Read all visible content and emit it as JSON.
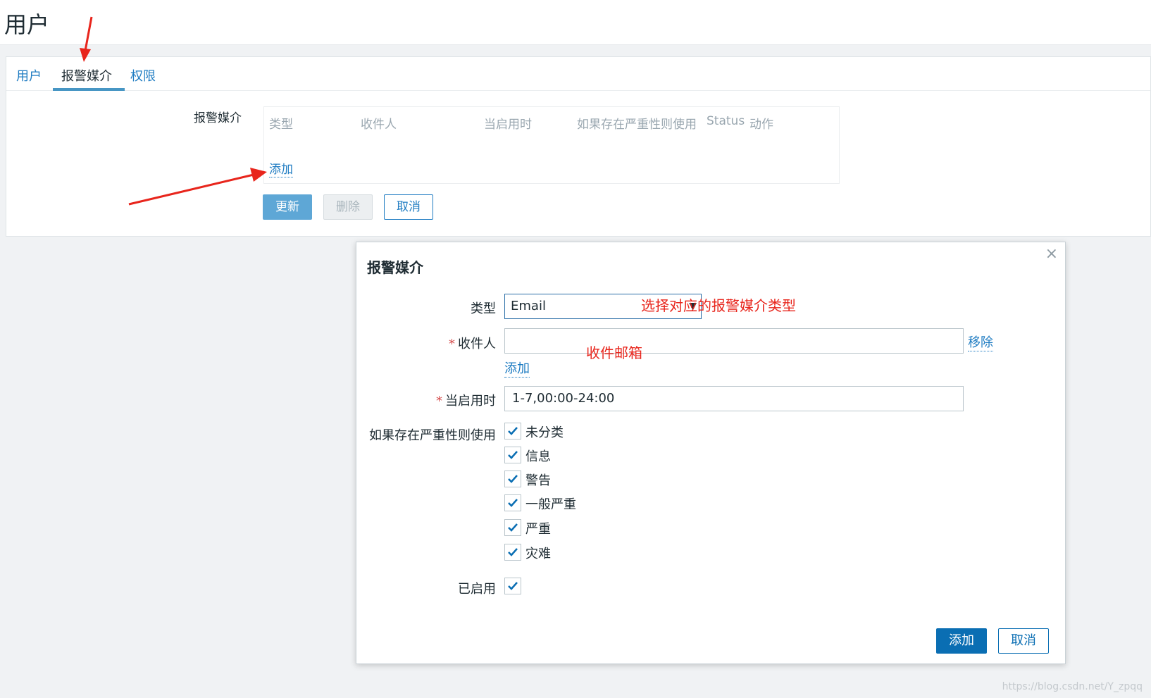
{
  "page": {
    "title": "用户"
  },
  "tabs": [
    {
      "label": "用户",
      "active": false
    },
    {
      "label": "报警媒介",
      "active": true
    },
    {
      "label": "权限",
      "active": false
    }
  ],
  "media_form": {
    "label": "报警媒介",
    "columns": [
      "类型",
      "收件人",
      "当启用时",
      "如果存在严重性则使用",
      "Status",
      "动作"
    ],
    "add_link": "添加",
    "buttons": {
      "update": "更新",
      "delete": "删除",
      "cancel": "取消"
    }
  },
  "modal": {
    "title": "报警媒介",
    "close_icon": "close-icon",
    "type_label": "类型",
    "type_value": "Email",
    "recipient_label": "收件人",
    "recipient_value": "",
    "remove_link": "移除",
    "add_link": "添加",
    "when_active_label": "当启用时",
    "when_active_value": "1-7,00:00-24:00",
    "severity_label": "如果存在严重性则使用",
    "severities": [
      {
        "label": "未分类",
        "checked": true
      },
      {
        "label": "信息",
        "checked": true
      },
      {
        "label": "警告",
        "checked": true
      },
      {
        "label": "一般严重",
        "checked": true
      },
      {
        "label": "严重",
        "checked": true
      },
      {
        "label": "灾难",
        "checked": true
      }
    ],
    "enabled_label": "已启用",
    "enabled": true,
    "buttons": {
      "add": "添加",
      "cancel": "取消"
    }
  },
  "annotations": {
    "type_note": "选择对应的报警媒介类型",
    "recipient_note": "收件邮箱"
  },
  "watermark": "https://blog.csdn.net/Y_zpqq",
  "colors": {
    "annotation": "#e8251c",
    "primary": "#0a6eb3",
    "link": "#1f7cc2"
  }
}
